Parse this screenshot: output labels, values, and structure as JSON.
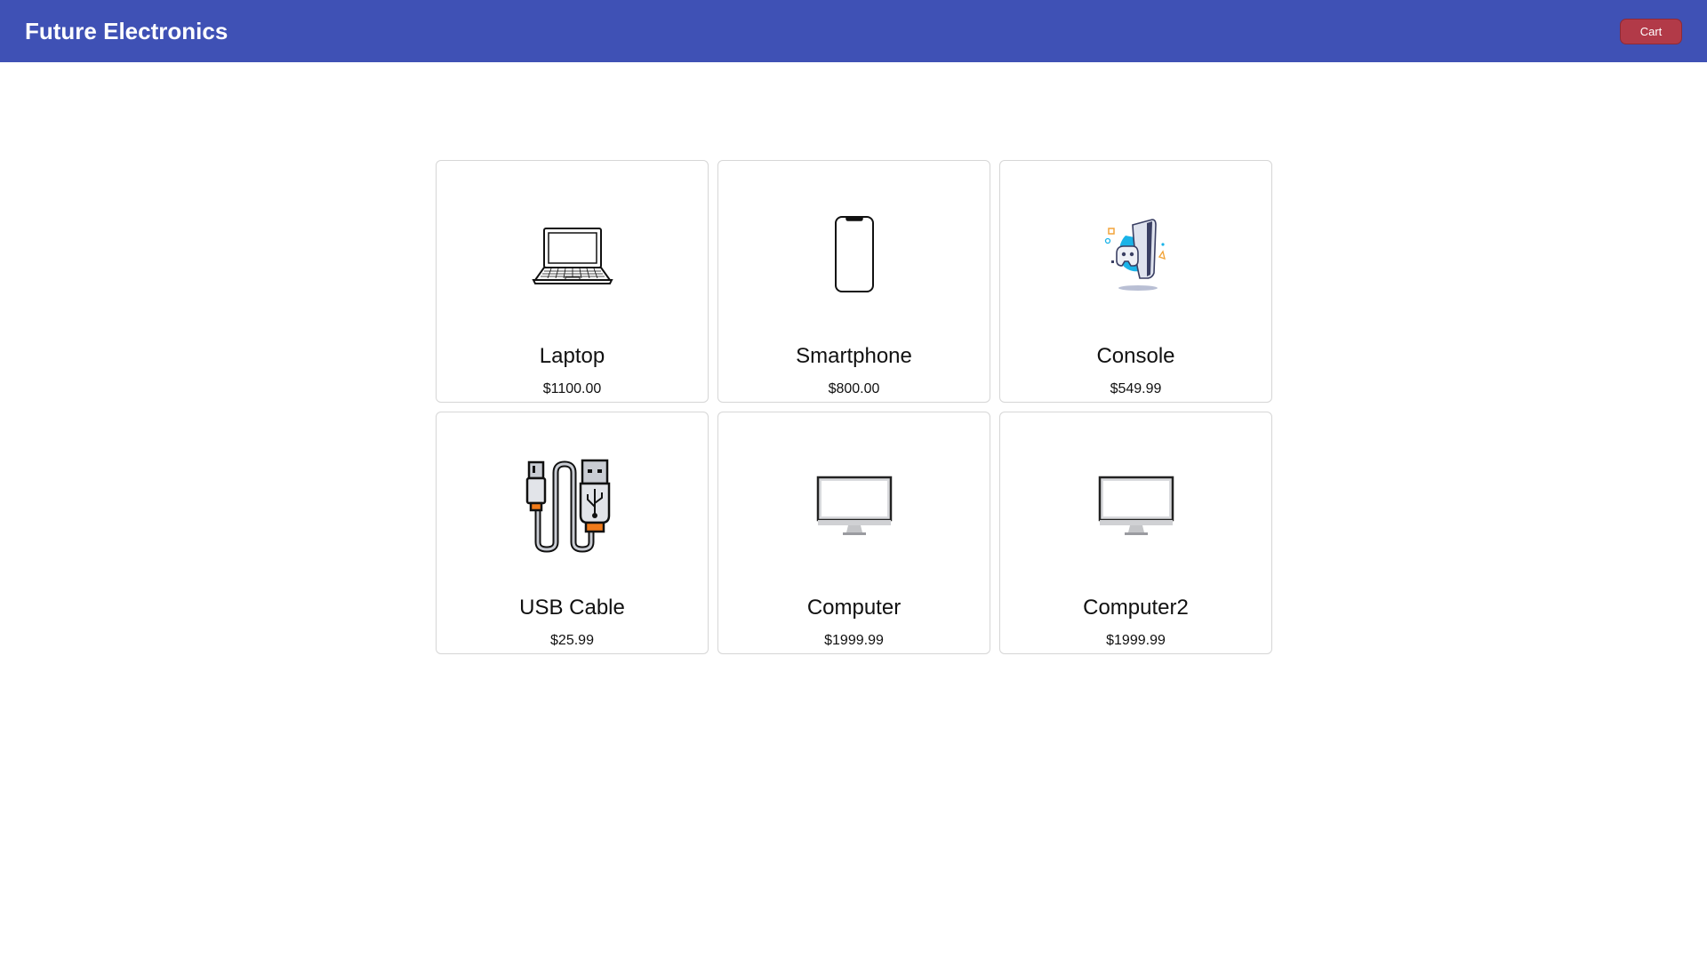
{
  "header": {
    "brand": "Future Electronics",
    "cart_label": "Cart",
    "color": "#3f51b5",
    "cart_color": "#b23a48"
  },
  "products": [
    {
      "name": "Laptop",
      "price": "$1100.00",
      "icon": "laptop-icon"
    },
    {
      "name": "Smartphone",
      "price": "$800.00",
      "icon": "smartphone-icon"
    },
    {
      "name": "Console",
      "price": "$549.99",
      "icon": "game-console-icon"
    },
    {
      "name": "USB Cable",
      "price": "$25.99",
      "icon": "usb-cable-icon"
    },
    {
      "name": "Computer",
      "price": "$1999.99",
      "icon": "monitor-icon"
    },
    {
      "name": "Computer2",
      "price": "$1999.99",
      "icon": "monitor-icon"
    }
  ]
}
